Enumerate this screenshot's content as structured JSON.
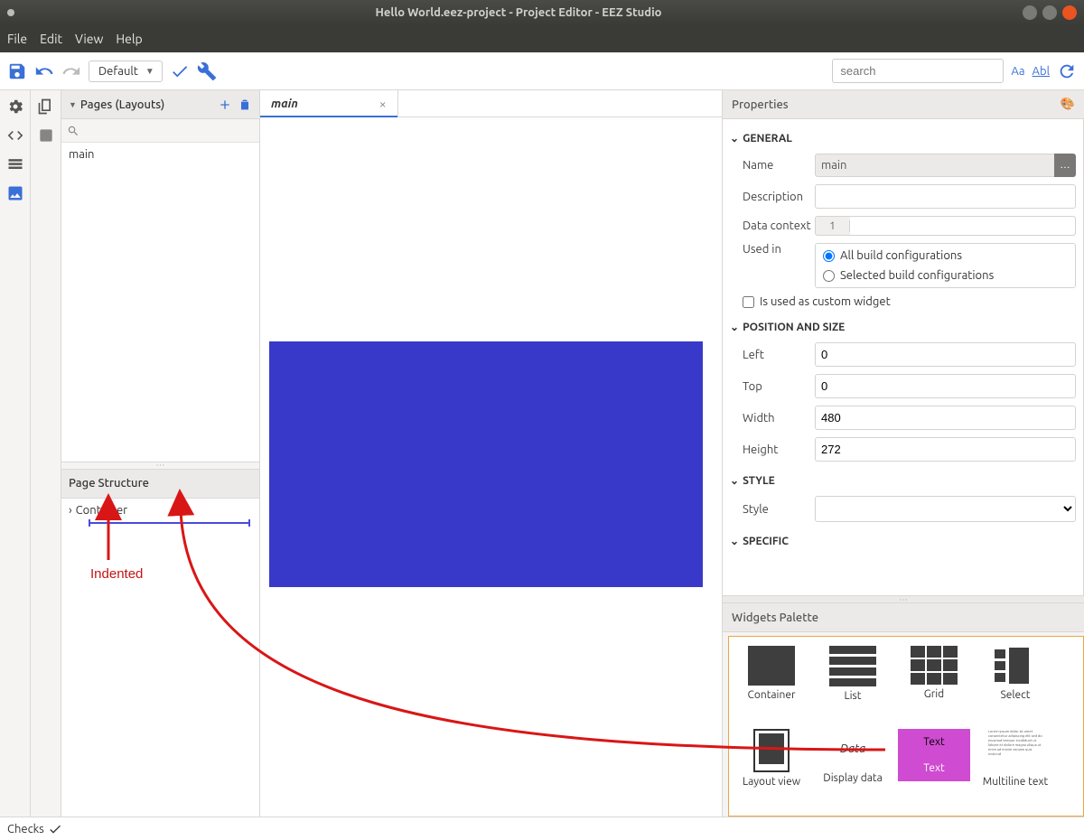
{
  "window": {
    "title": "Hello World.eez-project - Project Editor - EEZ Studio"
  },
  "menu": {
    "file": "File",
    "edit": "Edit",
    "view": "View",
    "help": "Help"
  },
  "toolbar": {
    "config": "Default",
    "search_placeholder": "search",
    "aa": "Aa",
    "abl": "Abl"
  },
  "pages_panel": {
    "title": "Pages (Layouts)",
    "items": [
      "main"
    ]
  },
  "structure_panel": {
    "title": "Page Structure",
    "item": "Container"
  },
  "canvas": {
    "tab": "main"
  },
  "properties": {
    "title": "Properties",
    "sections": {
      "general": "GENERAL",
      "position": "POSITION AND SIZE",
      "style": "STYLE",
      "specific": "SPECIFIC"
    },
    "labels": {
      "name": "Name",
      "description": "Description",
      "data_context": "Data context",
      "used_in": "Used in",
      "custom_widget": "Is used as custom widget",
      "left": "Left",
      "top": "Top",
      "width": "Width",
      "height": "Height",
      "style": "Style"
    },
    "values": {
      "name": "main",
      "description": "",
      "data_context_line": "1",
      "left": "0",
      "top": "0",
      "width": "480",
      "height": "272"
    },
    "radios": {
      "all": "All build configurations",
      "selected": "Selected build configurations"
    }
  },
  "palette": {
    "title": "Widgets Palette",
    "widgets": {
      "container": "Container",
      "list": "List",
      "grid": "Grid",
      "select": "Select",
      "layout": "Layout view",
      "display_data": "Display data",
      "data_label": "Data",
      "text": "Text",
      "text_inner": "Text",
      "multiline": "Multiline text"
    }
  },
  "status": {
    "checks": "Checks"
  },
  "annotation": {
    "indented": "Indented"
  }
}
